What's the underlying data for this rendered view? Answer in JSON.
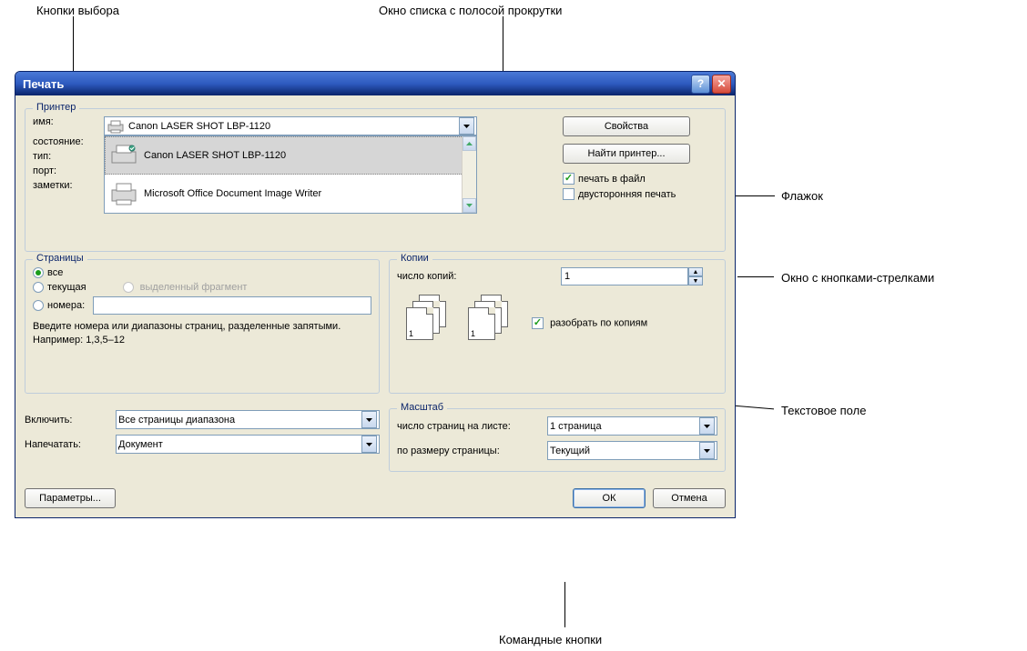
{
  "annotations": {
    "radio_buttons": "Кнопки выбора",
    "list_window": "Окно списка с полосой прокрутки",
    "checkbox_label": "Флажок",
    "spinner_label": "Окно с кнопками-стрелками",
    "textfield_label": "Текстовое поле",
    "command_buttons": "Командные кнопки"
  },
  "dialog": {
    "title": "Печать"
  },
  "printer": {
    "legend": "Принтер",
    "name_label": "имя:",
    "selected_name": "Canon LASER SHOT LBP-1120",
    "state_label": "состояние:",
    "type_label": "тип:",
    "port_label": "порт:",
    "notes_label": "заметки:",
    "properties_btn": "Свойства",
    "find_btn": "Найти принтер...",
    "to_file": "печать в файл",
    "duplex": "двусторонняя печать",
    "dropdown_items": {
      "item0": "Canon LASER SHOT LBP-1120",
      "item1": "Microsoft Office Document Image Writer"
    }
  },
  "pages": {
    "legend": "Страницы",
    "all": "все",
    "current": "текущая",
    "selection": "выделенный фрагмент",
    "numbers": "номера:",
    "hint": "Введите номера или диапазоны страниц, разделенные запятыми. Например: 1,3,5–12"
  },
  "copies": {
    "legend": "Копии",
    "count_label": "число копий:",
    "count_value": "1",
    "collate": "разобрать по копиям"
  },
  "scale": {
    "legend": "Масштаб",
    "pages_per_sheet_label": "число страниц на листе:",
    "pages_per_sheet_value": "1 страница",
    "fit_label": "по размеру страницы:",
    "fit_value": "Текущий"
  },
  "include": {
    "include_label": "Включить:",
    "include_value": "Все страницы диапазона",
    "print_label": "Напечатать:",
    "print_value": "Документ"
  },
  "buttons": {
    "params": "Параметры...",
    "ok": "ОК",
    "cancel": "Отмена"
  }
}
